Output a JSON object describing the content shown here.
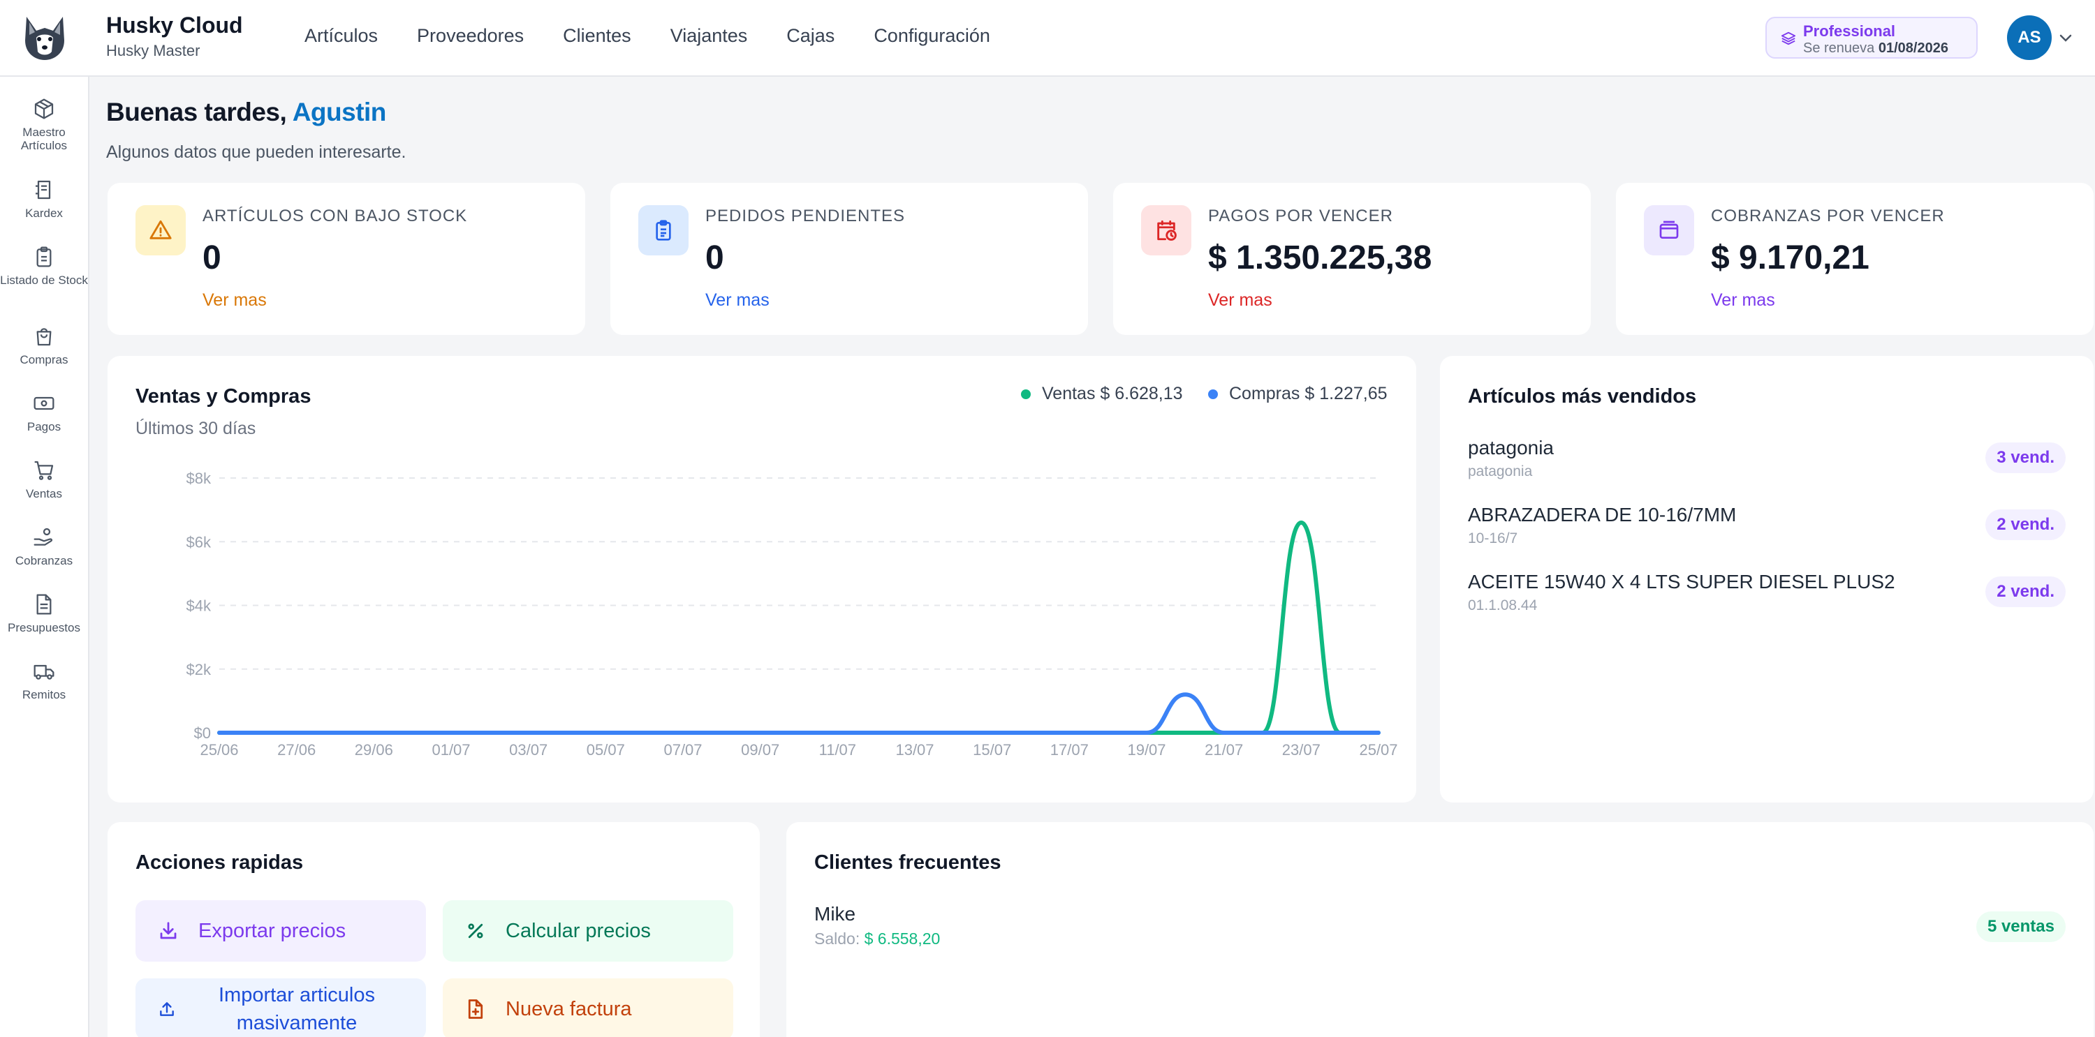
{
  "app": {
    "title": "Husky Cloud",
    "subtitle": "Husky Master"
  },
  "nav": [
    "Artículos",
    "Proveedores",
    "Clientes",
    "Viajantes",
    "Cajas",
    "Configuración"
  ],
  "plan": {
    "name": "Professional",
    "renew_label": "Se renueva",
    "renew_date": "01/08/2026"
  },
  "user": {
    "initials": "AS"
  },
  "sidebar": [
    {
      "label": "Maestro Artículos",
      "icon": "package-icon"
    },
    {
      "label": "Kardex",
      "icon": "ledger-icon"
    },
    {
      "label": "Listado de Stock",
      "icon": "clipboard-icon"
    },
    {
      "label": "Compras",
      "icon": "shopping-bag-icon"
    },
    {
      "label": "Pagos",
      "icon": "banknote-icon"
    },
    {
      "label": "Ventas",
      "icon": "cart-icon"
    },
    {
      "label": "Cobranzas",
      "icon": "hand-coins-icon"
    },
    {
      "label": "Presupuestos",
      "icon": "document-icon"
    },
    {
      "label": "Remitos",
      "icon": "truck-icon"
    }
  ],
  "greeting": {
    "prefix": "Buenas tardes,",
    "name": "Agustin",
    "subtitle": "Algunos datos que pueden interesarte."
  },
  "stats": [
    {
      "label": "ARTÍCULOS CON BAJO STOCK",
      "value": "0",
      "link": "Ver mas",
      "icon": "warning-icon",
      "color": "#d97706",
      "bg": "#fef3c7"
    },
    {
      "label": "PEDIDOS PENDIENTES",
      "value": "0",
      "link": "Ver mas",
      "icon": "clipboard-list-icon",
      "color": "#2563eb",
      "bg": "#dbeafe"
    },
    {
      "label": "PAGOS POR VENCER",
      "value": "$ 1.350.225,38",
      "link": "Ver mas",
      "icon": "calendar-clock-icon",
      "color": "#dc2626",
      "bg": "#fee2e2"
    },
    {
      "label": "COBRANZAS POR VENCER",
      "value": "$ 9.170,21",
      "link": "Ver mas",
      "icon": "wallet-icon",
      "color": "#7c3aed",
      "bg": "#ede9fe"
    }
  ],
  "sales_chart": {
    "title": "Ventas y Compras",
    "subtitle": "Últimos 30 días",
    "legend": [
      {
        "label": "Ventas $ 6.628,13",
        "color": "#10b981"
      },
      {
        "label": "Compras $ 1.227,65",
        "color": "#3b82f6"
      }
    ]
  },
  "chart_data": {
    "type": "line",
    "x": [
      "25/06",
      "26/06",
      "27/06",
      "28/06",
      "29/06",
      "30/06",
      "01/07",
      "02/07",
      "03/07",
      "04/07",
      "05/07",
      "06/07",
      "07/07",
      "08/07",
      "09/07",
      "10/07",
      "11/07",
      "12/07",
      "13/07",
      "14/07",
      "15/07",
      "16/07",
      "17/07",
      "18/07",
      "19/07",
      "20/07",
      "21/07",
      "22/07",
      "23/07",
      "24/07",
      "25/07"
    ],
    "xticks": [
      "25/06",
      "27/06",
      "29/06",
      "01/07",
      "03/07",
      "05/07",
      "07/07",
      "09/07",
      "11/07",
      "13/07",
      "15/07",
      "17/07",
      "19/07",
      "21/07",
      "23/07",
      "25/07"
    ],
    "series": [
      {
        "name": "Ventas",
        "color": "#10b981",
        "values": [
          0,
          0,
          0,
          0,
          0,
          0,
          0,
          0,
          0,
          0,
          0,
          0,
          0,
          0,
          0,
          0,
          0,
          0,
          0,
          0,
          0,
          0,
          0,
          0,
          0,
          0,
          0,
          0,
          6600,
          0,
          0
        ]
      },
      {
        "name": "Compras",
        "color": "#3b82f6",
        "values": [
          0,
          0,
          0,
          0,
          0,
          0,
          0,
          0,
          0,
          0,
          0,
          0,
          0,
          0,
          0,
          0,
          0,
          0,
          0,
          0,
          0,
          0,
          0,
          0,
          0,
          1200,
          0,
          0,
          0,
          0,
          0
        ]
      }
    ],
    "yticks": [
      "$0",
      "$2k",
      "$4k",
      "$6k",
      "$8k"
    ],
    "ylim": [
      0,
      8000
    ],
    "grid": true,
    "legend_position": "top-right"
  },
  "top_articles": {
    "title": "Artículos más vendidos",
    "items": [
      {
        "name": "patagonia",
        "code": "patagonia",
        "badge": "3 vend."
      },
      {
        "name": "ABRAZADERA DE 10-16/7MM",
        "code": "10-16/7",
        "badge": "2 vend."
      },
      {
        "name": "ACEITE 15W40 X 4 LTS SUPER DIESEL PLUS2",
        "code": "01.1.08.44",
        "badge": "2 vend."
      }
    ]
  },
  "quick_actions": {
    "title": "Acciones rapidas",
    "buttons": [
      {
        "label": "Exportar precios",
        "icon": "download-icon",
        "color": "#7c3aed",
        "bg": "#f3f0ff"
      },
      {
        "label": "Calcular precios",
        "icon": "percent-icon",
        "color": "#047857",
        "bg": "#ecfdf3"
      },
      {
        "label": "Importar articulos masivamente",
        "icon": "upload-icon",
        "color": "#1d4ed8",
        "bg": "#eef4ff"
      },
      {
        "label": "Nueva factura",
        "icon": "file-plus-icon",
        "color": "#c2410c",
        "bg": "#fff8e6"
      }
    ]
  },
  "frequent_clients": {
    "title": "Clientes frecuentes",
    "items": [
      {
        "name": "Mike",
        "balance_label": "Saldo:",
        "balance": "$ 6.558,20",
        "badge": "5 ventas"
      }
    ]
  }
}
